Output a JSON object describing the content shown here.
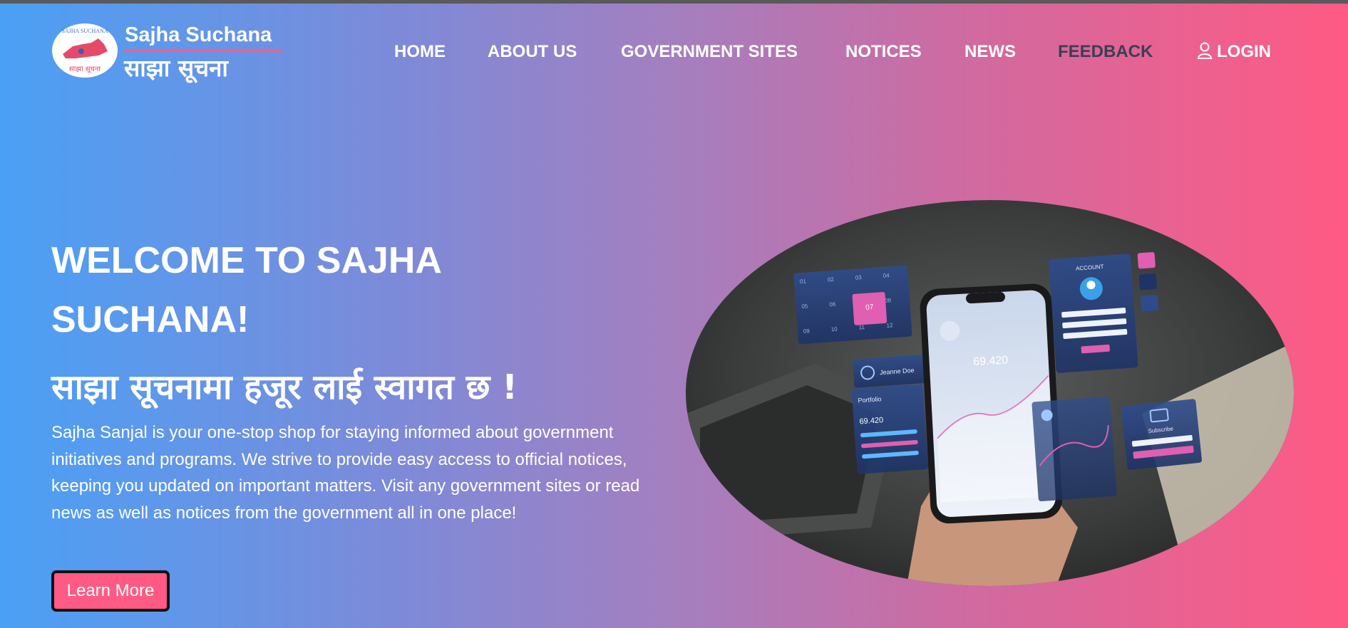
{
  "brand": {
    "name_en": "Sajha Suchana",
    "name_np": "साझा सूचना",
    "logo_text_top": "SAJHA SUCHANA",
    "logo_text_bottom": "साझा सूचना"
  },
  "nav": {
    "items": [
      {
        "label": "HOME"
      },
      {
        "label": "ABOUT US"
      },
      {
        "label": "GOVERNMENT SITES"
      },
      {
        "label": "NOTICES"
      },
      {
        "label": "NEWS"
      },
      {
        "label": "FEEDBACK",
        "active": true
      }
    ],
    "login_label": "LOGIN",
    "login_icon": "user-icon"
  },
  "hero": {
    "title_en": "WELCOME TO SAJHA SUCHANA!",
    "title_np": "साझा सूचनामा हजूर लाई स्वागत छ !",
    "description": "Sajha Sanjal is your one-stop shop for staying informed about government initiatives and programs. We strive to provide easy access to official notices, keeping you updated on important matters. Visit any government sites or read news as well as notices from the government all in one place!",
    "button_label": "Learn More"
  },
  "phone_mockup": {
    "user_name": "Jeanne Doe",
    "portfolio_label": "Portfolio",
    "portfolio_value": "69.420",
    "screen_value": "69.420",
    "account_label": "ACCOUNT",
    "subscribe_label": "Subscribe",
    "calendar_days": [
      "01",
      "02",
      "03",
      "04",
      "05",
      "06",
      "07",
      "08",
      "09",
      "10",
      "11",
      "12"
    ],
    "selected_day": "07"
  },
  "colors": {
    "gradient_start": "#4aa0f5",
    "gradient_end": "#ff5a84",
    "accent": "#ff5a84",
    "active_nav": "#3a3f55"
  }
}
